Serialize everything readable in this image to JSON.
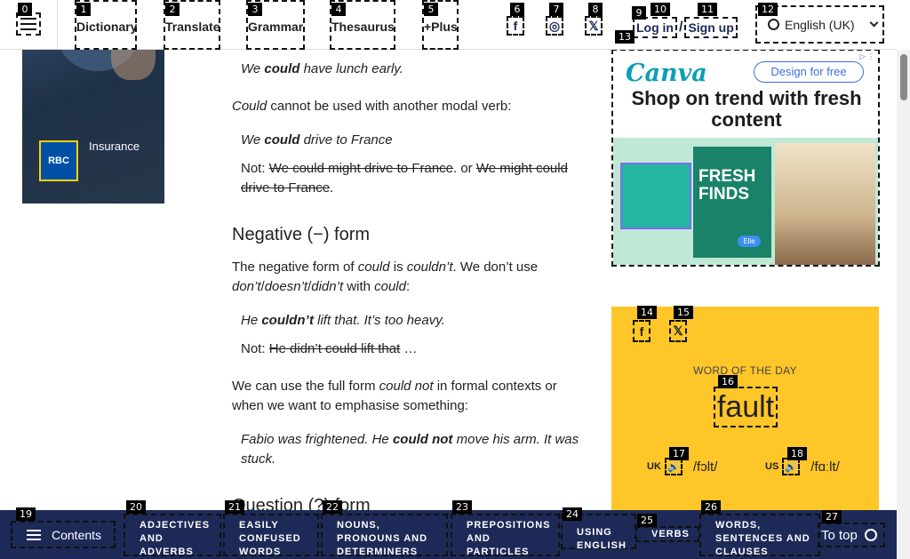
{
  "header": {
    "nav": [
      "Dictionary",
      "Translate",
      "Grammar",
      "Thesaurus",
      "+Plus"
    ],
    "social": [
      "facebook-icon",
      "instagram-icon",
      "x-icon"
    ],
    "login": "Log in",
    "separator": "/",
    "signup": "Sign up",
    "language": "English (UK)"
  },
  "left_ad": {
    "text": "Insurance",
    "logo": "RBC"
  },
  "article": {
    "ex1": {
      "pre": "We ",
      "bold": "could",
      "post": " have lunch early."
    },
    "p1": {
      "italic": "Could",
      "rest": " cannot be used with another modal verb:"
    },
    "ex2": {
      "pre": "We ",
      "bold": "could",
      "post": " drive to France"
    },
    "not1": {
      "label": "Not: ",
      "strike1": "We could might drive to France",
      "mid": ". or ",
      "strike2": "We might could drive to France",
      "end": "."
    },
    "h_negative": "Negative (−) form",
    "p2": {
      "a": "The negative form of ",
      "b": "could",
      "c": " is ",
      "d": "couldn’t",
      "e": ". We don’t use ",
      "f": "don’t",
      "g": "/",
      "h": "doesn’t",
      "i": "/",
      "j": "didn’t",
      "k": " with ",
      "l": "could",
      "m": ":"
    },
    "ex3": {
      "pre": "He ",
      "bold": "couldn’t",
      "post": " lift that. It’s too heavy."
    },
    "not2": {
      "label": "Not: ",
      "strike": "He didn’t could lift that",
      "end": " …"
    },
    "p3": {
      "a": "We can use the full form ",
      "b": "could not",
      "c": " in formal contexts or when we want to emphasise something:"
    },
    "ex4": {
      "pre": "Fabio was frightened. He ",
      "bold": "could not",
      "post": " move his arm. It was stuck."
    },
    "h_question": "Question (?) form"
  },
  "canva_ad": {
    "logo": "Canva",
    "button": "Design for free",
    "headline": "Shop on trend with fresh content",
    "art_text": "FRESH FINDS",
    "pill": "Elle"
  },
  "wotd": {
    "social": [
      "facebook-icon",
      "x-icon"
    ],
    "label": "WORD OF THE DAY",
    "word": "fault",
    "uk_label": "UK",
    "uk_ipa": "/fɔlt/",
    "us_label": "US",
    "us_ipa": "/fɑːlt/"
  },
  "bottom_bar": {
    "contents": "Contents",
    "items": [
      [
        "ADJECTIVES",
        "AND",
        "ADVERBS"
      ],
      [
        "EASILY",
        "CONFUSED",
        "WORDS"
      ],
      [
        "NOUNS,",
        "PRONOUNS AND",
        "DETERMINERS"
      ],
      [
        "PREPOSITIONS",
        "AND",
        "PARTICLES"
      ],
      [
        "USING",
        "ENGLISH"
      ],
      [
        "VERBS"
      ],
      [
        "WORDS,",
        "SENTENCES AND",
        "CLAUSES"
      ]
    ],
    "to_top": "To top"
  },
  "tags": [
    "0",
    "1",
    "2",
    "3",
    "4",
    "5",
    "6",
    "7",
    "8",
    "9",
    "10",
    "11",
    "12",
    "13",
    "14",
    "15",
    "16",
    "17",
    "18",
    "19",
    "20",
    "21",
    "22",
    "23",
    "24",
    "25",
    "26",
    "27"
  ],
  "colors": {
    "navy": "#1d2a57",
    "wotd_bg": "#fec628",
    "canva_teal": "#0c9fb5"
  }
}
